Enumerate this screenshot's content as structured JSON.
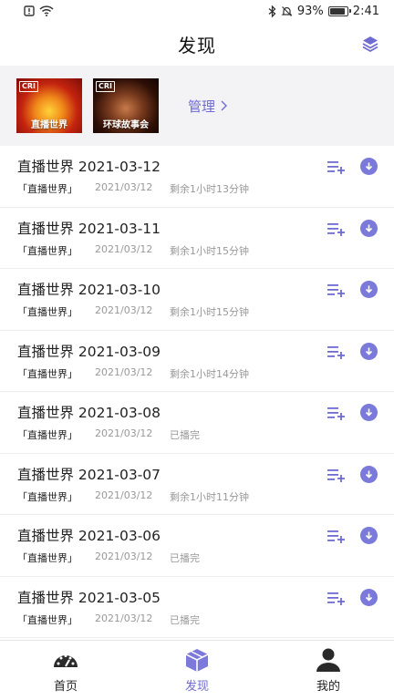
{
  "status": {
    "battery": "93%",
    "battery_level": 0.93,
    "time": "2:41"
  },
  "header": {
    "title": "发现",
    "layers_icon": "layers-icon"
  },
  "subscriptions": [
    {
      "caption": "直播世界",
      "logo": "CRI"
    },
    {
      "caption": "环球故事会",
      "logo": "CRI"
    }
  ],
  "manage_label": "管理 ",
  "episodes": [
    {
      "title": "直播世界 2021-03-12",
      "source": "「直播世界」",
      "date": "2021/03/12",
      "status": "剩余1小时13分钟"
    },
    {
      "title": "直播世界 2021-03-11",
      "source": "「直播世界」",
      "date": "2021/03/12",
      "status": "剩余1小时15分钟"
    },
    {
      "title": "直播世界 2021-03-10",
      "source": "「直播世界」",
      "date": "2021/03/12",
      "status": "剩余1小时15分钟"
    },
    {
      "title": "直播世界 2021-03-09",
      "source": "「直播世界」",
      "date": "2021/03/12",
      "status": "剩余1小时14分钟"
    },
    {
      "title": "直播世界 2021-03-08",
      "source": "「直播世界」",
      "date": "2021/03/12",
      "status": "已播完"
    },
    {
      "title": "直播世界 2021-03-07",
      "source": "「直播世界」",
      "date": "2021/03/12",
      "status": "剩余1小时11分钟"
    },
    {
      "title": "直播世界 2021-03-06",
      "source": "「直播世界」",
      "date": "2021/03/12",
      "status": "已播完"
    },
    {
      "title": "直播世界 2021-03-05",
      "source": "「直播世界」",
      "date": "2021/03/12",
      "status": "已播完"
    }
  ],
  "tabs": [
    {
      "label": "首页",
      "icon": "dashboard-icon"
    },
    {
      "label": "发现",
      "icon": "cube-icon"
    },
    {
      "label": "我的",
      "icon": "person-icon"
    }
  ],
  "colors": {
    "accent": "#6e6bd1",
    "download": "#7b79d9",
    "subscription_bg": "#f3f3f5"
  }
}
